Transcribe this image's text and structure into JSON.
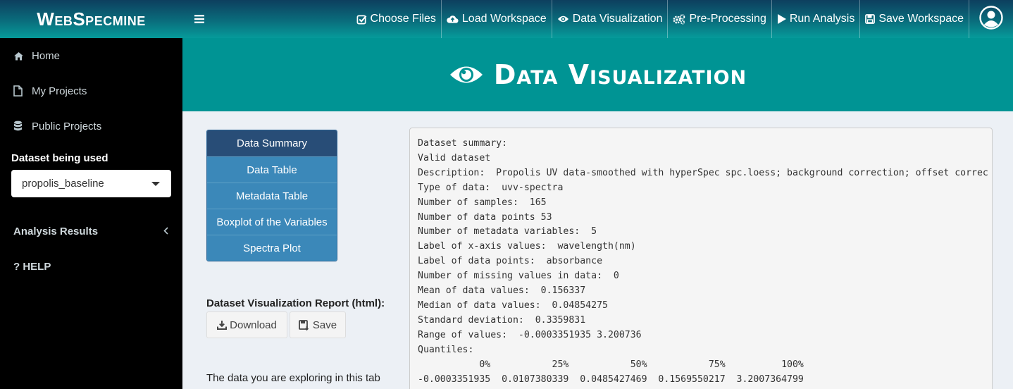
{
  "brand": {
    "name": "WebSpecmine"
  },
  "topnav": {
    "menu_toggle_icon": "bars-icon",
    "items": [
      {
        "label": "Choose Files",
        "icon": "check-square-icon"
      },
      {
        "label": "Load Workspace",
        "icon": "cloud-upload-icon"
      },
      {
        "label": "Data Visualization",
        "icon": "eye-icon"
      },
      {
        "label": "Pre-Processing",
        "icon": "gears-icon"
      },
      {
        "label": "Run Analysis",
        "icon": "play-icon"
      },
      {
        "label": "Save Workspace",
        "icon": "floppy-icon"
      }
    ],
    "user_icon": "user-circle-icon"
  },
  "sidebar": {
    "items": [
      {
        "label": "Home",
        "icon": "home-icon"
      },
      {
        "label": "My Projects",
        "icon": "file-icon"
      },
      {
        "label": "Public Projects",
        "icon": "database-icon"
      }
    ],
    "dataset_label": "Dataset being used",
    "dataset_value": "propolis_baseline",
    "analysis_label": "Analysis Results",
    "help_label": "? HELP"
  },
  "page": {
    "title": "Data Visualization",
    "title_icon": "eye-icon"
  },
  "tabs": [
    {
      "label": "Data Summary",
      "active": true
    },
    {
      "label": "Data Table",
      "active": false
    },
    {
      "label": "Metadata Table",
      "active": false
    },
    {
      "label": "Boxplot of the Variables",
      "active": false
    },
    {
      "label": "Spectra Plot",
      "active": false
    }
  ],
  "report": {
    "label": "Dataset Visualization Report (html):",
    "download_label": "Download",
    "save_label": "Save",
    "note": "The data you are exploring in this tab"
  },
  "summary": {
    "lines": [
      "Dataset summary:",
      "Valid dataset",
      "Description:  Propolis UV data-smoothed with hyperSpec spc.loess; background correction; offset correc",
      "Type of data:  uvv-spectra",
      "Number of samples:  165",
      "Number of data points 53",
      "Number of metadata variables:  5",
      "Label of x-axis values:  wavelength(nm)",
      "Label of data points:  absorbance",
      "Number of missing values in data:  0",
      "Mean of data values:  0.156337",
      "Median of data values:  0.04854275",
      "Standard deviation:  0.3359831",
      "Range of values:  -0.0003351935 3.200736",
      "Quantiles:",
      "           0%           25%           50%           75%          100%",
      "-0.0003351935  0.0107380339  0.0485427469  0.1569550217  3.2007364799"
    ]
  },
  "colors": {
    "header_gradient_top": "#0d3f5e",
    "header_gradient_bottom": "#069a9a",
    "banner": "#009494",
    "sidebar": "#000000",
    "tab_active": "#284d77",
    "tab": "#3b88b9",
    "content_bg": "#ecf0f5"
  }
}
